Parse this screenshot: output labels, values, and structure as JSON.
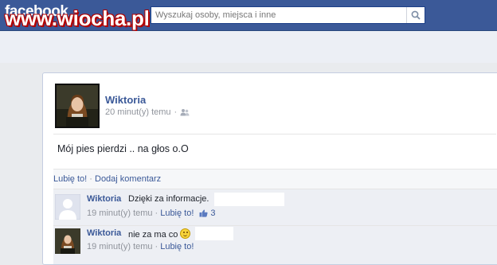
{
  "topbar": {
    "logo": "facebook",
    "watermark": "www.wiocha.pl",
    "search_placeholder": "Wyszukaj osoby, miejsca i inne",
    "search_icon": "search-icon"
  },
  "post": {
    "author": "Wiktoria",
    "time": "20 minut(y) temu",
    "separator": "·",
    "audience_icon": "friends-icon",
    "text": "Mój pies pierdzi .. na głos o.O",
    "actions": {
      "like": "Lubię to!",
      "separator": "·",
      "comment": "Dodaj komentarz"
    }
  },
  "comments": [
    {
      "author": "Wiktoria",
      "text": "Dzięki za informacje.",
      "time": "19 minut(y) temu",
      "separator": "·",
      "like": "Lubię to!",
      "likes_icon": "thumbs-up-icon",
      "likes": "3"
    },
    {
      "author": "Wiktoria",
      "text": "nie za ma co",
      "emoji": "smiley-icon",
      "time": "19 minut(y) temu",
      "separator": "·",
      "like": "Lubię to!"
    }
  ],
  "colors": {
    "brand": "#3b5998",
    "link": "#3b5998",
    "muted": "#90949c",
    "watermark_outline": "#b30000"
  }
}
